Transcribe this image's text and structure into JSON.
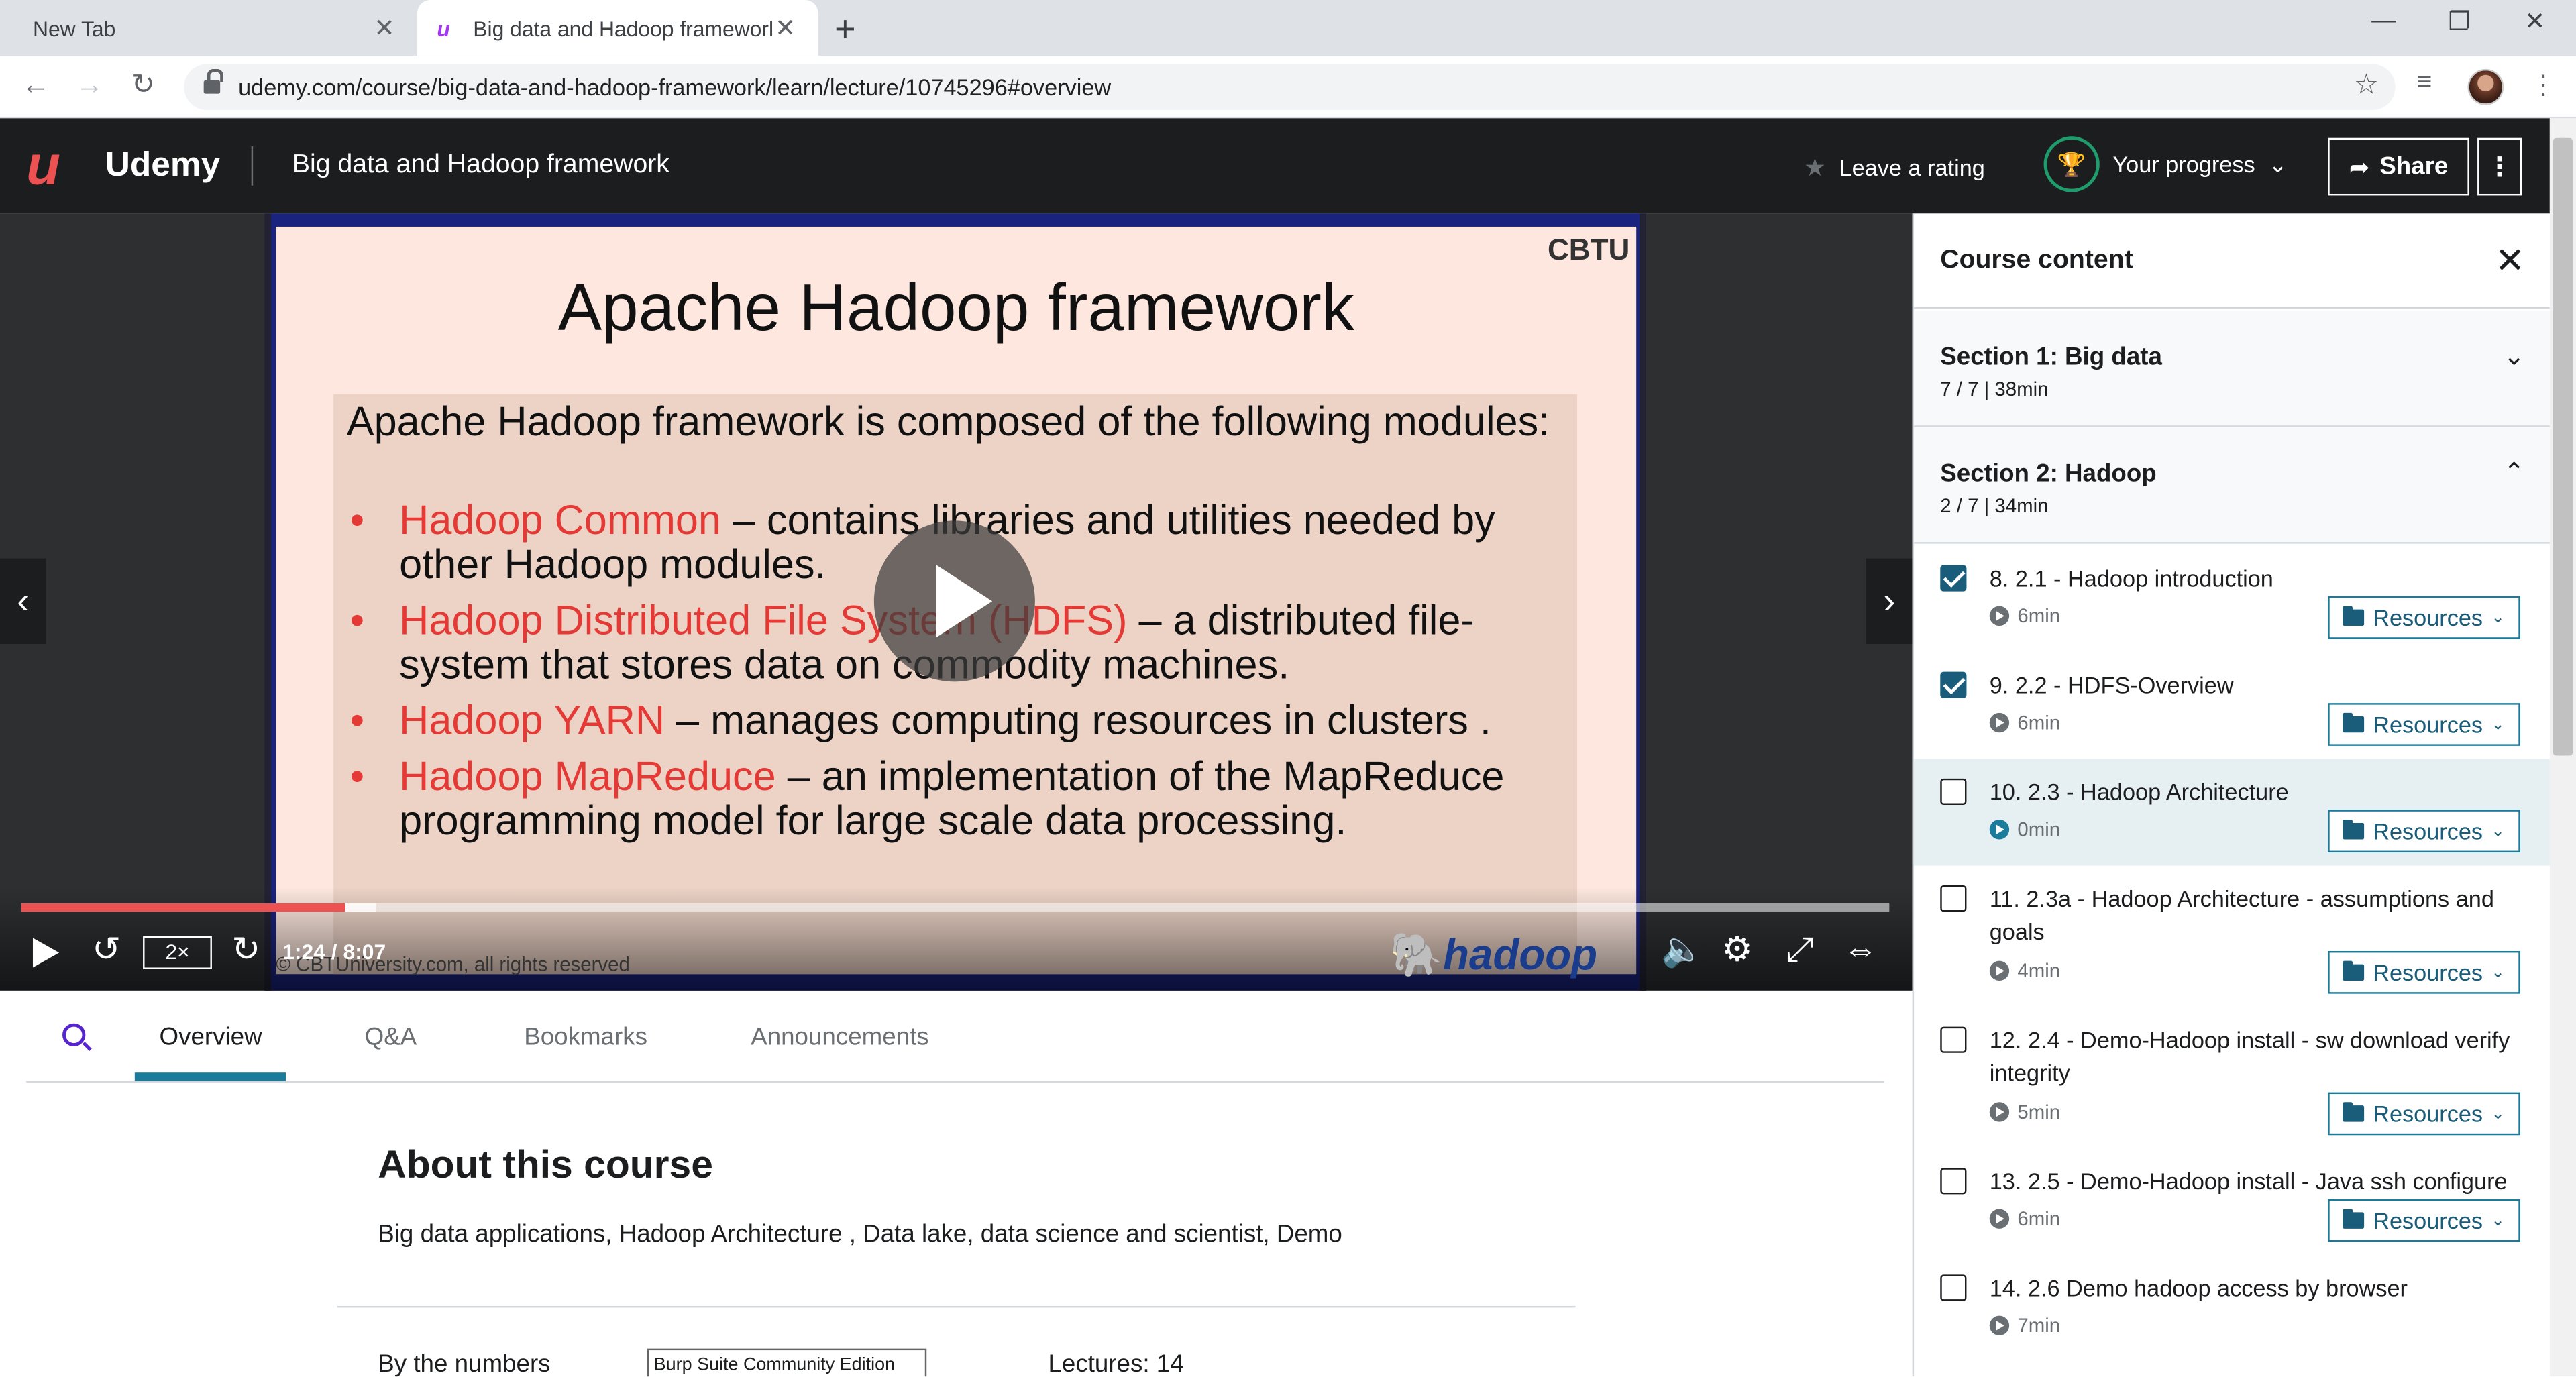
{
  "browser": {
    "tabs": [
      {
        "title": "New Tab",
        "active": false
      },
      {
        "title": "Big data and Hadoop framework",
        "active": true
      }
    ],
    "url": "udemy.com/course/big-data-and-hadoop-framework/learn/lecture/10745296#overview"
  },
  "header": {
    "logo_text": "Udemy",
    "course_title": "Big data and Hadoop framework",
    "rating_label": "Leave a rating",
    "progress_label": "Your progress",
    "share_label": "Share"
  },
  "video": {
    "slide_badge": "CBTU",
    "slide_title": "Apache Hadoop framework",
    "slide_intro": "Apache Hadoop framework is composed of the following modules:",
    "bullets": [
      {
        "name": "Hadoop Common",
        "text": " – contains libraries and utilities needed by other Hadoop modules."
      },
      {
        "name": "Hadoop Distributed File System (HDFS)",
        "text": " – a distributed file-system that stores data on commodity machines."
      },
      {
        "name": "Hadoop YARN",
        "text": " – manages computing resources in clusters ."
      },
      {
        "name": "Hadoop MapReduce",
        "text": " – an implementation of the MapReduce programming model for large scale data processing."
      }
    ],
    "copyright": "© CBTUniversity.com, all rights reserved",
    "watermark": "hadoop",
    "time": "1:24 / 8:07",
    "speed": "2×",
    "progress_fraction": 0.173,
    "buffered_fraction": 0.19
  },
  "content_tabs": [
    "Overview",
    "Q&A",
    "Bookmarks",
    "Announcements"
  ],
  "about": {
    "title": "About this course",
    "description": "Big data applications, Hadoop Architecture , Data lake, data science and scientist, Demo",
    "numbers_label": "By the numbers",
    "overlay_text": "Burp Suite Community Edition",
    "lectures": "Lectures: 14"
  },
  "sidebar": {
    "title": "Course content",
    "sections": [
      {
        "title": "Section 1: Big data",
        "meta": "7 / 7 | 38min",
        "expanded": false
      },
      {
        "title": "Section 2: Hadoop",
        "meta": "2 / 7 | 34min",
        "expanded": true
      }
    ],
    "resources_label": "Resources",
    "lectures": [
      {
        "title": "8. 2.1 - Hadoop introduction",
        "duration": "6min",
        "done": true,
        "current": false,
        "resources": true
      },
      {
        "title": "9. 2.2 - HDFS-Overview",
        "duration": "6min",
        "done": true,
        "current": false,
        "resources": true
      },
      {
        "title": "10. 2.3 - Hadoop Architecture",
        "duration": "0min",
        "done": false,
        "current": true,
        "resources": true
      },
      {
        "title": "11. 2.3a - Hadoop Architecture - assumptions and goals",
        "duration": "4min",
        "done": false,
        "current": false,
        "resources": true
      },
      {
        "title": "12. 2.4 - Demo-Hadoop install - sw download verify integrity",
        "duration": "5min",
        "done": false,
        "current": false,
        "resources": true
      },
      {
        "title": "13. 2.5 - Demo-Hadoop install - Java ssh configure",
        "duration": "6min",
        "done": false,
        "current": false,
        "resources": true
      },
      {
        "title": "14. 2.6 Demo hadoop access by browser",
        "duration": "7min",
        "done": false,
        "current": false,
        "resources": false
      }
    ]
  }
}
